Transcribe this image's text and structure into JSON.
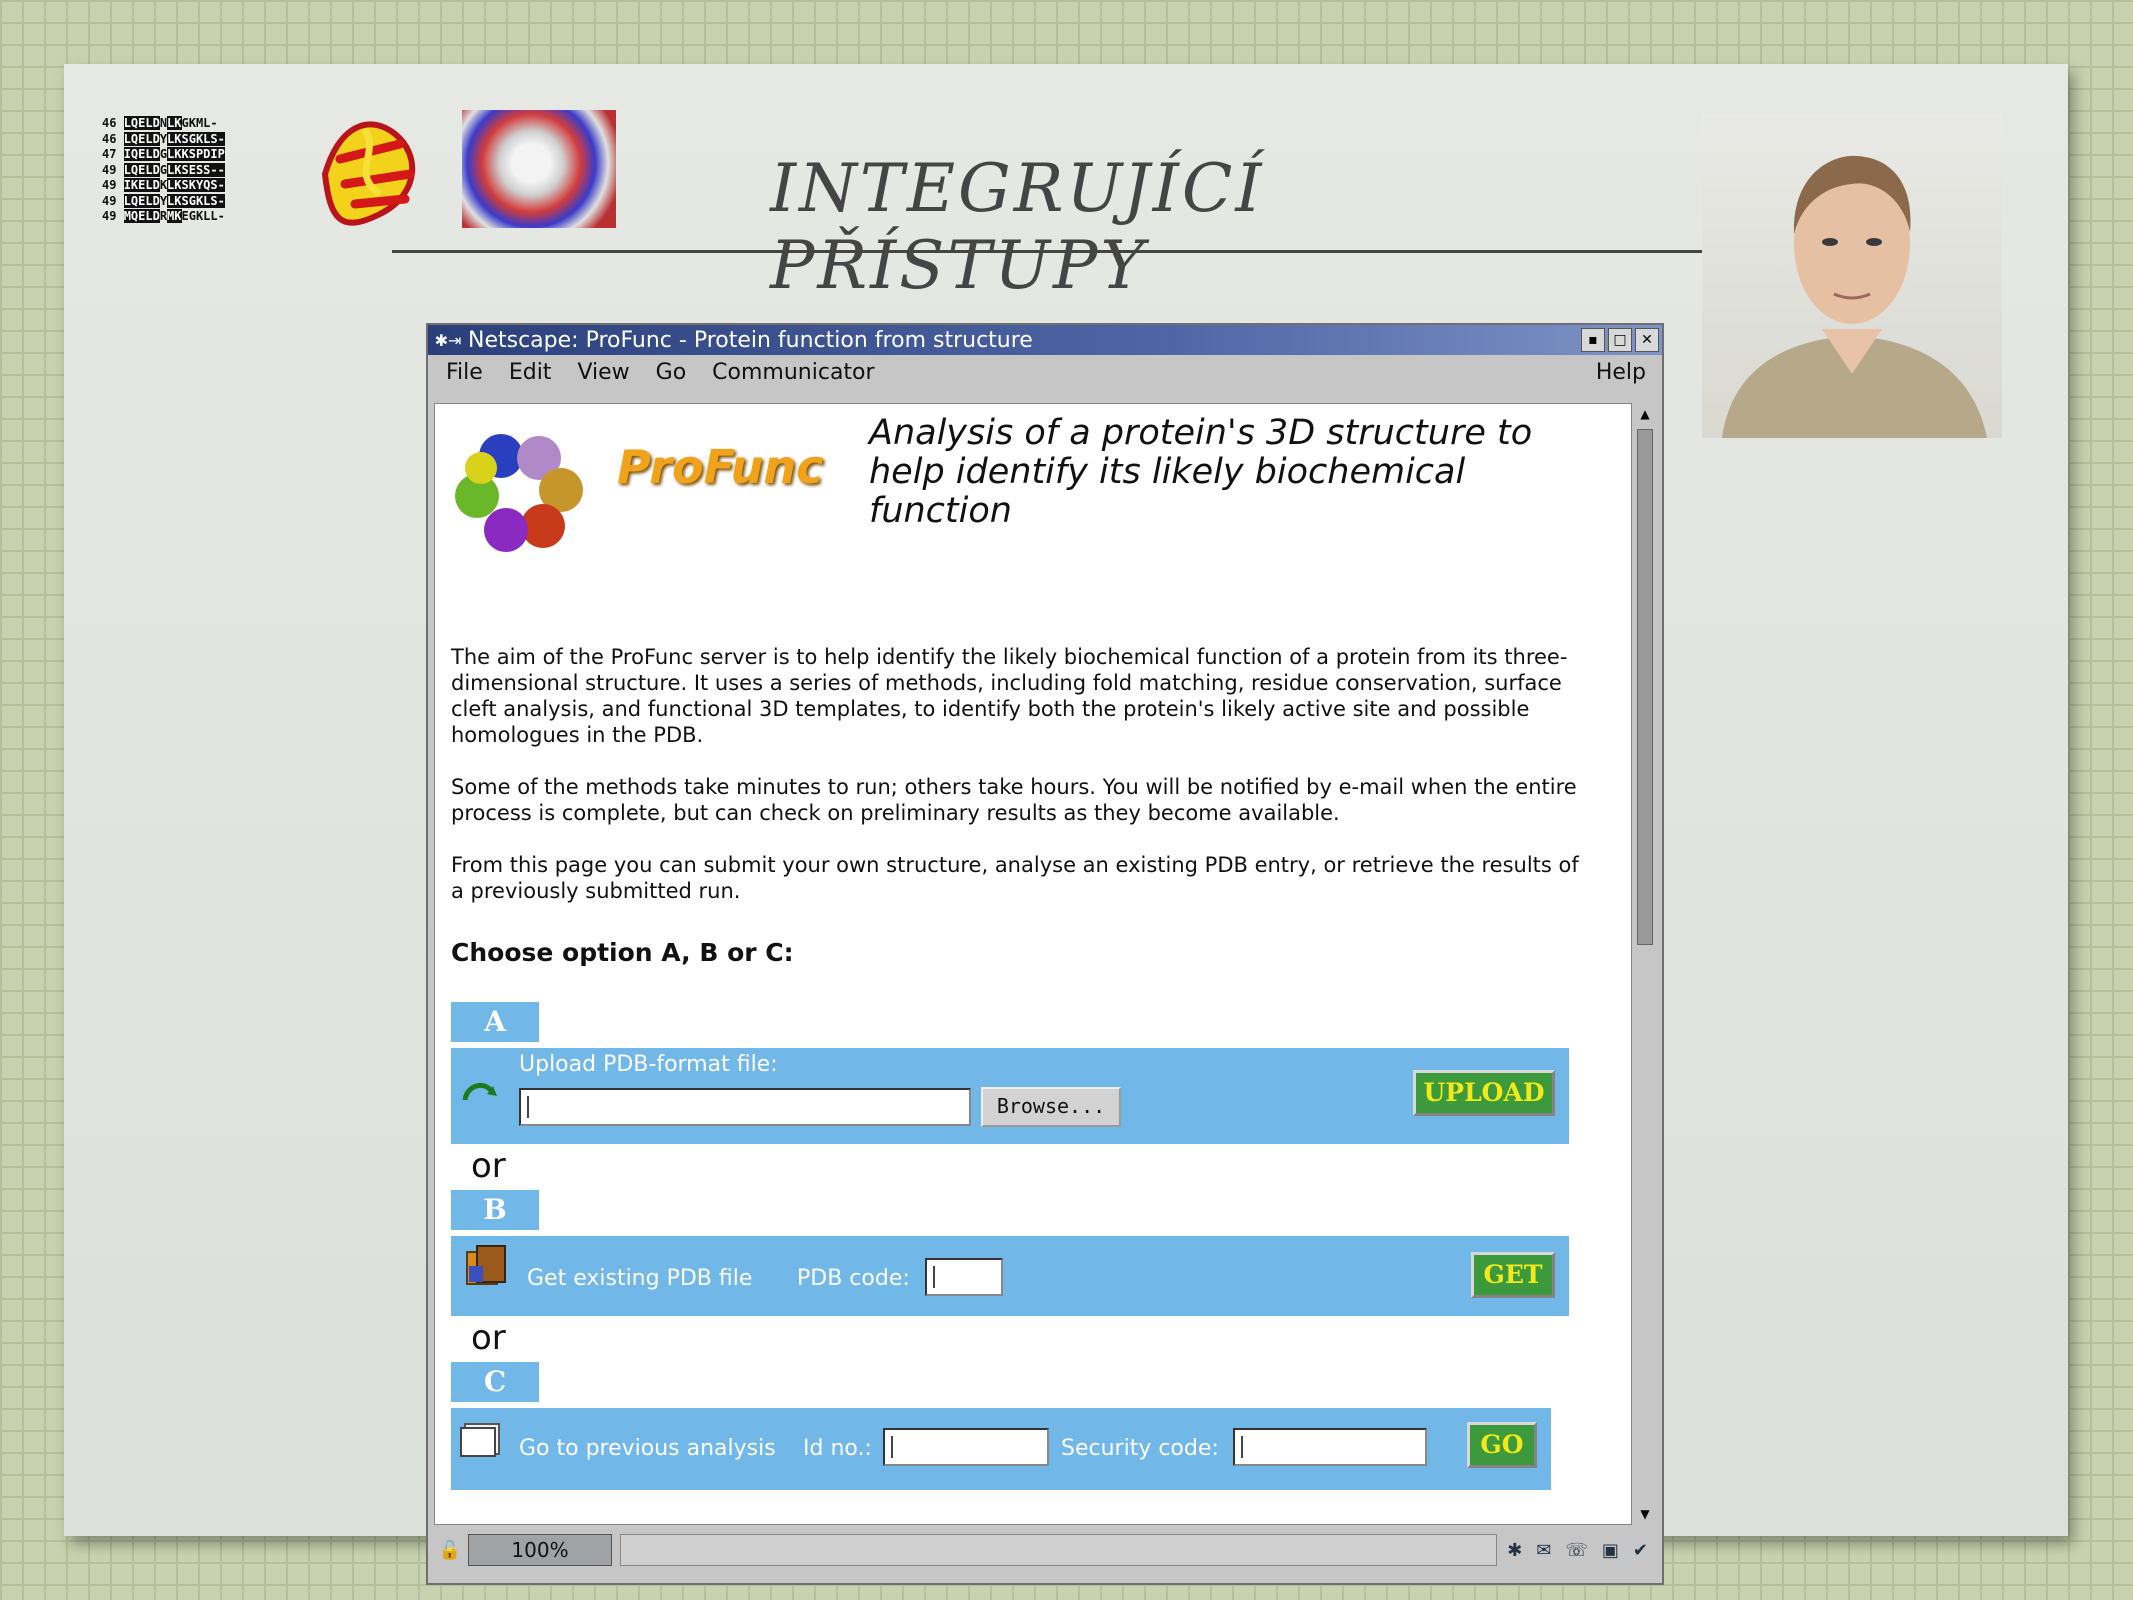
{
  "slide": {
    "title": "INTEGRUJÍCÍ PŘÍSTUPY",
    "sequence_rows": [
      [
        "46",
        "LQELD",
        "N",
        "LK",
        "G",
        "KML-"
      ],
      [
        "46",
        "LQELD",
        "Y",
        "LKSGKLS-",
        "",
        ""
      ],
      [
        "47",
        "IQELD",
        "G",
        "LKKSPDIP",
        "",
        ""
      ],
      [
        "49",
        "LQELD",
        "G",
        "LKSESS--",
        "",
        ""
      ],
      [
        "49",
        "IKELD",
        "K",
        "LKSKYQS-",
        "",
        ""
      ],
      [
        "49",
        "LQELD",
        "Y",
        "LKSGKLS-",
        "",
        ""
      ],
      [
        "49",
        "MQELD",
        "R",
        "MK",
        "E",
        "GKLL-"
      ]
    ]
  },
  "browser": {
    "window_title": "Netscape: ProFunc - Protein function from structure",
    "menu": [
      "File",
      "Edit",
      "View",
      "Go",
      "Communicator"
    ],
    "help": "Help",
    "zoom": "100%"
  },
  "page": {
    "brand": "ProFunc",
    "tagline": "Analysis of a protein's 3D structure to help identify its likely biochemical function",
    "paragraphs": [
      "The aim of the ProFunc server is to help identify the likely biochemical function of a protein from its three-dimensional structure. It uses a series of methods, including fold matching, residue conservation, surface cleft analysis, and functional 3D templates, to identify both the protein's likely active site and possible homologues in the PDB.",
      "Some of the methods take minutes to run; others take hours. You will be notified by e-mail when the entire process is complete, but can check on preliminary results as they become available.",
      "From this page you can submit your own structure, analyse an existing PDB entry, or retrieve the results of a previously submitted run."
    ],
    "choose": "Choose option A, B or C:",
    "or": "or",
    "option_a": {
      "label": "A",
      "prompt": "Upload PDB-format file:",
      "browse": "Browse...",
      "button": "UPLOAD"
    },
    "option_b": {
      "label": "B",
      "prompt": "Get existing PDB file",
      "code_label": "PDB code:",
      "button": "GET"
    },
    "option_c": {
      "label": "C",
      "prompt": "Go to previous analysis",
      "id_label": "Id no.:",
      "security_label": "Security code:",
      "button": "GO"
    }
  }
}
